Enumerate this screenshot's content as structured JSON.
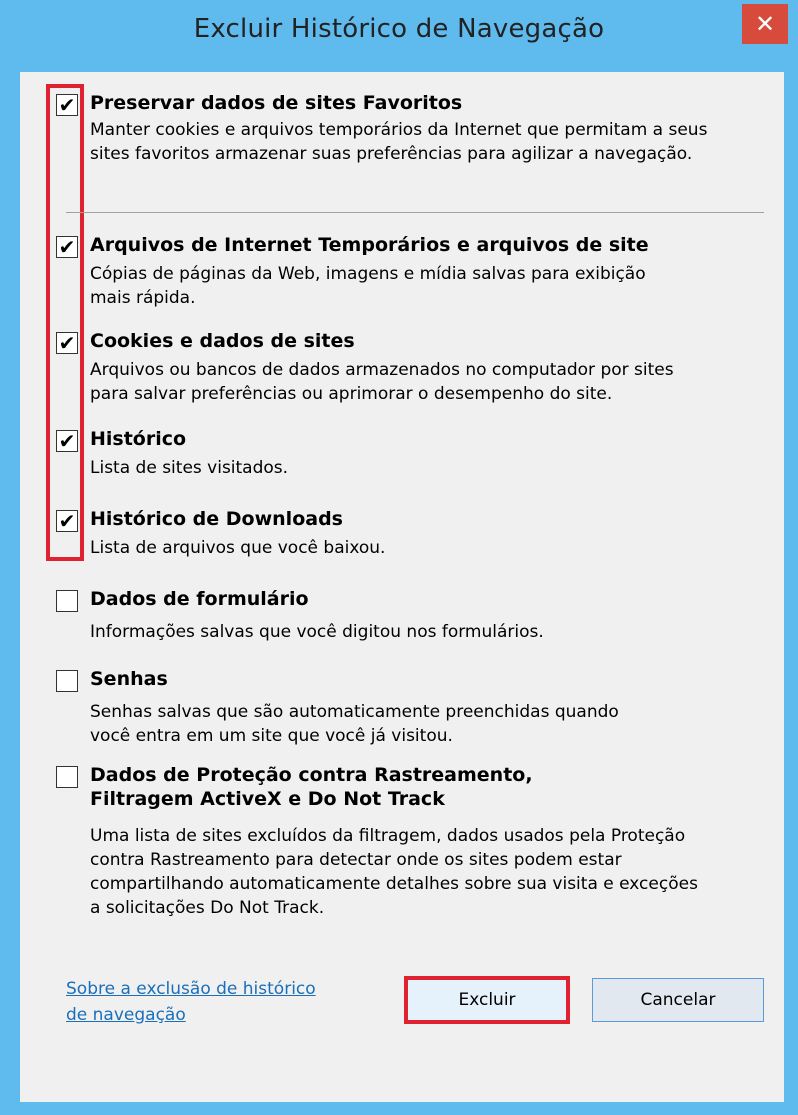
{
  "window": {
    "title": "Excluir Histórico de Navegação",
    "close_glyph": "✕"
  },
  "options": [
    {
      "label": "Preservar dados de sites Favoritos",
      "description": "Manter cookies e arquivos temporários da Internet que permitam a seus\nsites favoritos armazenar suas preferências para agilizar a navegação.",
      "checked": true
    },
    {
      "label": "Arquivos de Internet Temporários e arquivos de site",
      "description": "Cópias de páginas da Web, imagens e mídia salvas para exibição\nmais rápida.",
      "checked": true
    },
    {
      "label": "Cookies e dados de sites",
      "description": "Arquivos ou bancos de dados armazenados no computador por sites\npara salvar preferências ou aprimorar o desempenho do site.",
      "checked": true
    },
    {
      "label": "Histórico",
      "description": "Lista de sites visitados.",
      "checked": true
    },
    {
      "label": "Histórico de Downloads",
      "description": "Lista de arquivos que você baixou.",
      "checked": true
    },
    {
      "label": "Dados de formulário",
      "description": "Informações salvas que você digitou nos formulários.",
      "checked": false
    },
    {
      "label": "Senhas",
      "description": "Senhas salvas que são automaticamente preenchidas quando\nvocê entra em um site que você já visitou.",
      "checked": false
    },
    {
      "label": "Dados de Proteção contra Rastreamento,\nFiltragem ActiveX e Do Not Track",
      "description": "Uma lista de sites excluídos da filtragem, dados usados pela Proteção\ncontra Rastreamento para detectar onde os sites podem estar\ncompartilhando automaticamente detalhes sobre sua visita e exceções\na solicitações Do Not Track.",
      "checked": false
    }
  ],
  "footer": {
    "link_text": "Sobre a exclusão de histórico\nde navegação",
    "delete_label": "Excluir",
    "cancel_label": "Cancelar"
  },
  "colors": {
    "title_bar": "#5fbbee",
    "close_button": "#d74b3c",
    "highlight": "#e0212f",
    "link": "#1a6fb8"
  },
  "icons": {
    "checkmark": "✔"
  }
}
